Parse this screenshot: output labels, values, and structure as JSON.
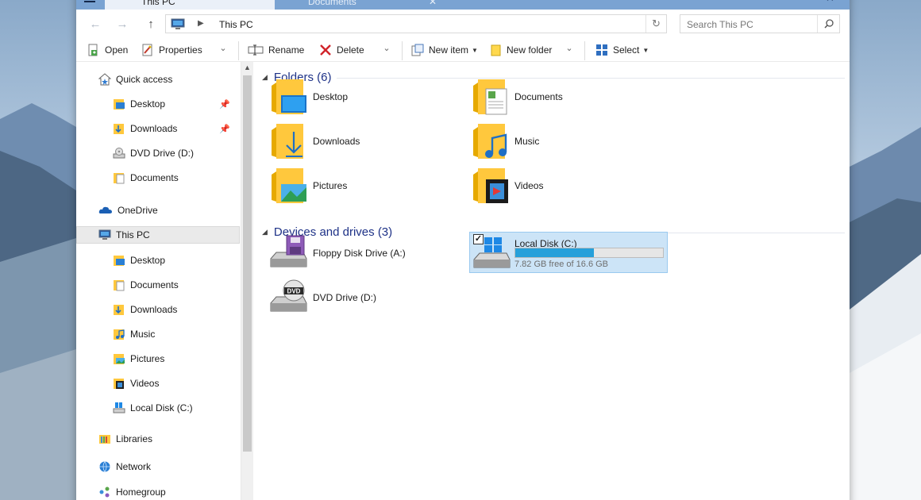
{
  "tabs": {
    "active": "This PC",
    "inactive": "Documents"
  },
  "nav": {
    "back": "←",
    "forward": "→",
    "up": "↑"
  },
  "address": {
    "crumb": "This PC"
  },
  "search": {
    "placeholder": "Search This PC"
  },
  "toolbar": {
    "open": "Open",
    "properties": "Properties",
    "rename": "Rename",
    "delete": "Delete",
    "new_item": "New item",
    "new_folder": "New folder",
    "select": "Select"
  },
  "sidebar": {
    "items": [
      {
        "label": "Quick access",
        "icon": "star-home-icon"
      },
      {
        "label": "Desktop",
        "icon": "desktop-folder-icon",
        "pinned": true
      },
      {
        "label": "Downloads",
        "icon": "downloads-folder-icon",
        "pinned": true
      },
      {
        "label": "DVD Drive (D:)",
        "icon": "dvd-drive-icon"
      },
      {
        "label": "Documents",
        "icon": "documents-folder-icon"
      },
      {
        "label": "OneDrive",
        "icon": "onedrive-icon"
      },
      {
        "label": "This PC",
        "icon": "this-pc-icon",
        "selected": true
      },
      {
        "label": "Desktop",
        "icon": "desktop-folder-icon"
      },
      {
        "label": "Documents",
        "icon": "documents-folder-icon"
      },
      {
        "label": "Downloads",
        "icon": "downloads-folder-icon"
      },
      {
        "label": "Music",
        "icon": "music-folder-icon"
      },
      {
        "label": "Pictures",
        "icon": "pictures-folder-icon"
      },
      {
        "label": "Videos",
        "icon": "videos-folder-icon"
      },
      {
        "label": "Local Disk (C:)",
        "icon": "local-disk-icon"
      },
      {
        "label": "Libraries",
        "icon": "libraries-icon"
      },
      {
        "label": "Network",
        "icon": "network-icon"
      },
      {
        "label": "Homegroup",
        "icon": "homegroup-icon"
      }
    ]
  },
  "main": {
    "folders_header": "Folders (6)",
    "folders": [
      {
        "label": "Desktop",
        "icon": "desktop-folder-icon"
      },
      {
        "label": "Documents",
        "icon": "documents-folder-icon"
      },
      {
        "label": "Downloads",
        "icon": "downloads-folder-icon"
      },
      {
        "label": "Music",
        "icon": "music-folder-icon"
      },
      {
        "label": "Pictures",
        "icon": "pictures-folder-icon"
      },
      {
        "label": "Videos",
        "icon": "videos-folder-icon"
      }
    ],
    "devices_header": "Devices and drives (3)",
    "drives": [
      {
        "label": "Floppy Disk Drive (A:)",
        "icon": "floppy-drive-icon"
      },
      {
        "label": "Local Disk (C:)",
        "icon": "local-disk-icon",
        "free_text": "7.82 GB free of 16.6 GB",
        "used_fraction": 0.53,
        "selected": true,
        "checked": true
      },
      {
        "label": "DVD Drive (D:)",
        "icon": "dvd-drive-icon"
      }
    ]
  },
  "colors": {
    "accent": "#26a0da",
    "group_header": "#1e3287",
    "tab_bar": "#7aa3d2",
    "selection": "#cce4f7"
  }
}
